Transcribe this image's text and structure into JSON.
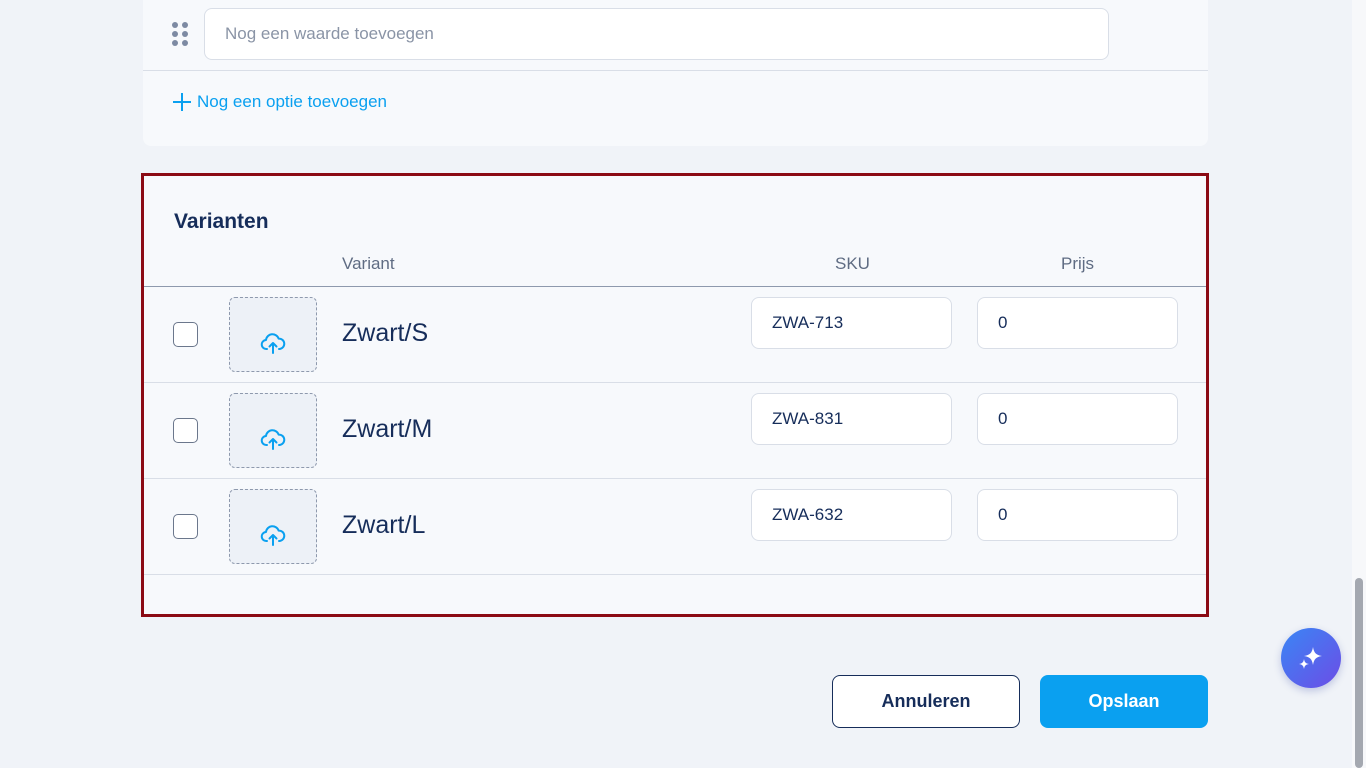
{
  "options": {
    "value_placeholder": "Nog een waarde toevoegen",
    "add_option_label": "Nog een optie toevoegen"
  },
  "variants": {
    "title": "Varianten",
    "columns": {
      "variant": "Variant",
      "sku": "SKU",
      "price": "Prijs"
    },
    "rows": [
      {
        "name": "Zwart/S",
        "sku": "ZWA-713",
        "price": "0",
        "checked": false
      },
      {
        "name": "Zwart/M",
        "sku": "ZWA-831",
        "price": "0",
        "checked": false
      },
      {
        "name": "Zwart/L",
        "sku": "ZWA-632",
        "price": "0",
        "checked": false
      }
    ]
  },
  "footer": {
    "cancel_label": "Annuleren",
    "save_label": "Opslaan"
  },
  "icons": {
    "drag": "drag-handle-icon",
    "plus": "plus-icon",
    "upload": "cloud-upload-icon",
    "ai": "sparkle-icon"
  },
  "colors": {
    "accent": "#0aa0f0",
    "text_primary": "#162d5a",
    "highlight_border": "#8b0a14",
    "fab_gradient_start": "#3a86f5",
    "fab_gradient_end": "#6c4de6"
  }
}
